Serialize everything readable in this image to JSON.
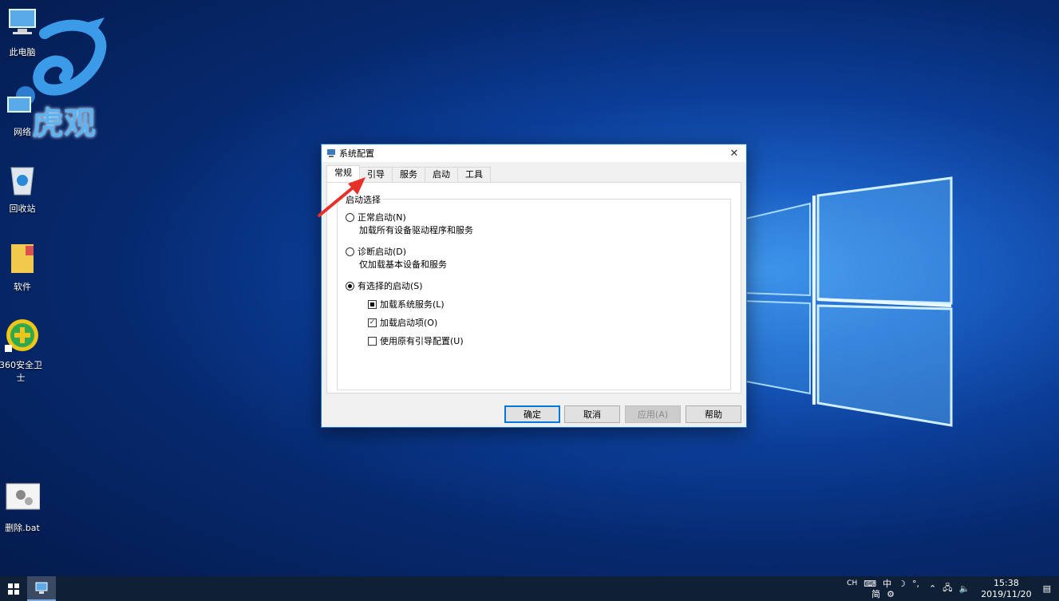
{
  "desktop": {
    "brand_text": "虎观",
    "icons": [
      {
        "label": "此电脑"
      },
      {
        "label": "网络"
      },
      {
        "label": "回收站"
      },
      {
        "label": "软件"
      },
      {
        "label": "360安全卫士"
      },
      {
        "label": "删除.bat"
      }
    ]
  },
  "dialog": {
    "title": "系统配置",
    "tabs": [
      "常规",
      "引导",
      "服务",
      "启动",
      "工具"
    ],
    "active_tab": "常规",
    "group_label": "启动选择",
    "options": {
      "normal": {
        "label": "正常启动(N)",
        "desc": "加载所有设备驱动程序和服务",
        "selected": false
      },
      "diagnostic": {
        "label": "诊断启动(D)",
        "desc": "仅加载基本设备和服务",
        "selected": false
      },
      "selective": {
        "label": "有选择的启动(S)",
        "selected": true
      }
    },
    "checks": {
      "load_services": {
        "label": "加载系统服务(L)",
        "state": "mixed"
      },
      "load_startup": {
        "label": "加载启动项(O)",
        "state": "checked"
      },
      "original_boot": {
        "label": "使用原有引导配置(U)",
        "state": "unchecked"
      }
    },
    "buttons": {
      "ok": "确定",
      "cancel": "取消",
      "apply": "应用(A)",
      "help": "帮助"
    }
  },
  "taskbar": {
    "ime_mode": "CH",
    "ime_lang": "中",
    "ime_simplified": "简",
    "time": "15:38",
    "date": "2019/11/20"
  },
  "colors": {
    "accent": "#0078d7",
    "annotation_arrow": "#e8302a"
  }
}
